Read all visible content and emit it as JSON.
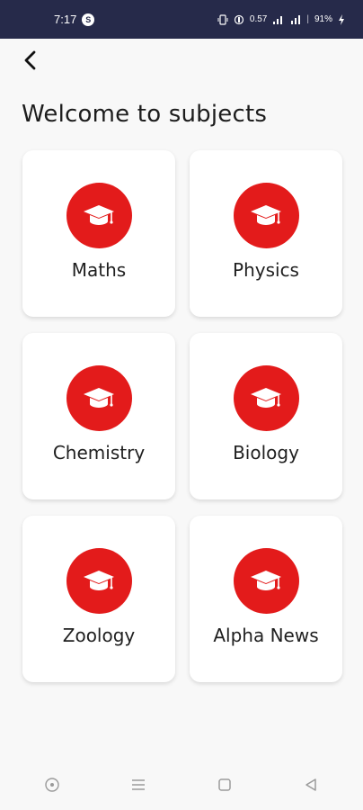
{
  "status_bar": {
    "time": "7:17",
    "notification_badge": "S",
    "network_speed": "0.57",
    "battery": "91%"
  },
  "header": {
    "back_icon": "chevron-left-icon",
    "title": "Welcome to subjects"
  },
  "subjects": [
    {
      "label": "Maths",
      "icon": "graduation-cap-icon"
    },
    {
      "label": "Physics",
      "icon": "graduation-cap-icon"
    },
    {
      "label": "Chemistry",
      "icon": "graduation-cap-icon"
    },
    {
      "label": "Biology",
      "icon": "graduation-cap-icon"
    },
    {
      "label": "Zoology",
      "icon": "graduation-cap-icon"
    },
    {
      "label": "Alpha News",
      "icon": "graduation-cap-icon"
    }
  ],
  "nav_bar": {
    "items": [
      "assistant-icon",
      "menu-icon",
      "home-square-icon",
      "back-triangle-icon"
    ]
  },
  "colors": {
    "status_bar_bg": "#262a4a",
    "accent": "#e31b1b",
    "card_bg": "#ffffff",
    "page_bg": "#f8f8f8"
  }
}
